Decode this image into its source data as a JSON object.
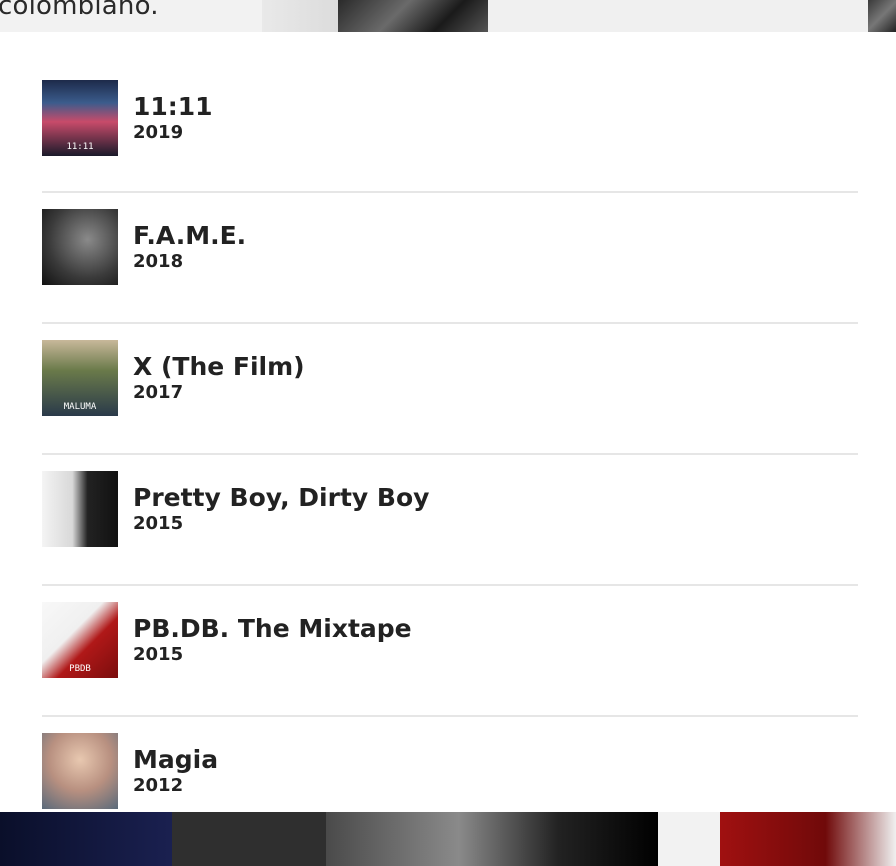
{
  "background": {
    "top_text": "colombiano."
  },
  "albums": [
    {
      "title": "11:11",
      "year": "2019",
      "cover_icon": "album-cover-11-11",
      "cover_text": "11:11"
    },
    {
      "title": "F.A.M.E.",
      "year": "2018",
      "cover_icon": "album-cover-fame"
    },
    {
      "title": "X (The Film)",
      "year": "2017",
      "cover_icon": "album-cover-x-the-film",
      "cover_text": "MALUMA"
    },
    {
      "title": "Pretty Boy, Dirty Boy",
      "year": "2015",
      "cover_icon": "album-cover-pretty-boy-dirty-boy"
    },
    {
      "title": "PB.DB. The Mixtape",
      "year": "2015",
      "cover_icon": "album-cover-pbdb-mixtape",
      "cover_text": "PBDB"
    },
    {
      "title": "Magia",
      "year": "2012",
      "cover_icon": "album-cover-magia"
    }
  ]
}
